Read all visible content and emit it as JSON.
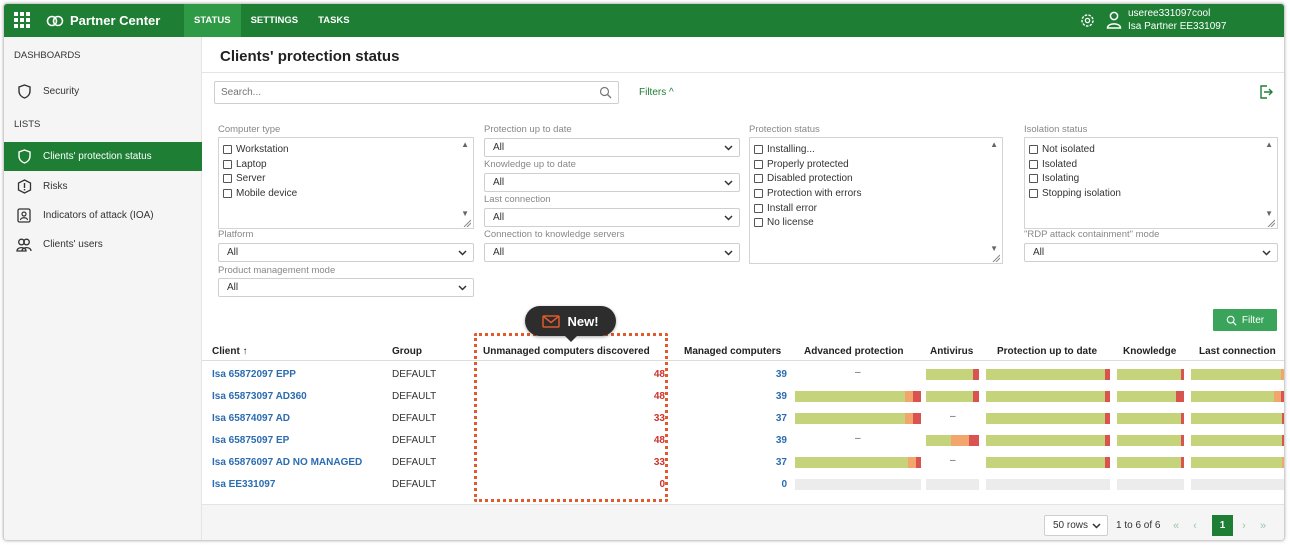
{
  "colors": {
    "brand": "#1e7e34",
    "bar_green": "#c5d47b",
    "bar_orange": "#f2a56c",
    "bar_red": "#d9534f",
    "bar_empty": "#ececec",
    "unmanaged_red": "#d0312d",
    "link_blue": "#2b6cb0",
    "highlight": "#e05a2b"
  },
  "topbar": {
    "apps_icon": "apps-grid-icon",
    "brand": "Partner Center",
    "nav": [
      "STATUS",
      "SETTINGS",
      "TASKS"
    ],
    "user_name": "useree331097cool",
    "user_org": "Isa Partner EE331097"
  },
  "sidebar": {
    "dashboards_label": "DASHBOARDS",
    "lists_label": "LISTS",
    "items": [
      {
        "label": "Security",
        "icon": "shield-icon"
      },
      {
        "label": "Clients' protection status",
        "icon": "shield-icon"
      },
      {
        "label": "Risks",
        "icon": "alert-icon"
      },
      {
        "label": "Indicators of attack (IOA)",
        "icon": "indicator-icon"
      },
      {
        "label": "Clients' users",
        "icon": "users-icon"
      }
    ]
  },
  "main": {
    "title": "Clients' protection status",
    "search_placeholder": "Search...",
    "filters_label": "Filters ^",
    "filter_button": "Filter",
    "filters": {
      "computer_type": {
        "label": "Computer type",
        "options": [
          "Workstation",
          "Laptop",
          "Server",
          "Mobile device"
        ]
      },
      "protection_up_to_date": {
        "label": "Protection up to date",
        "value": "All"
      },
      "knowledge_up_to_date": {
        "label": "Knowledge up to date",
        "value": "All"
      },
      "last_connection": {
        "label": "Last connection",
        "value": "All"
      },
      "connection_knowledge_servers": {
        "label": "Connection to knowledge servers",
        "value": "All"
      },
      "protection_status": {
        "label": "Protection status",
        "options": [
          "Installing...",
          "Properly protected",
          "Disabled protection",
          "Protection with errors",
          "Install error",
          "No license"
        ]
      },
      "isolation_status": {
        "label": "Isolation status",
        "options": [
          "Not isolated",
          "Isolated",
          "Isolating",
          "Stopping isolation"
        ]
      },
      "rdp_mode": {
        "label": "\"RDP attack containment\" mode",
        "value": "All"
      },
      "platform": {
        "label": "Platform",
        "value": "All"
      },
      "product_management_mode": {
        "label": "Product management mode",
        "value": "All"
      }
    },
    "new_badge": "New!",
    "table": {
      "columns": [
        "Client ↑",
        "Group",
        "Unmanaged computers discovered",
        "Managed computers",
        "Advanced protection",
        "Antivirus",
        "Protection up to date",
        "Knowledge",
        "Last connection"
      ],
      "dash": "–",
      "rows": [
        {
          "client": "Isa 65872097 EPP",
          "group": "DEFAULT",
          "unmanaged": "48",
          "managed": "39",
          "advanced": null,
          "antivirus": [
            0.88,
            0,
            0.12
          ],
          "protection": [
            0.96,
            0,
            0.04
          ],
          "knowledge": [
            0.96,
            0,
            0.04
          ],
          "last_connection": [
            0.95,
            0.05,
            0
          ]
        },
        {
          "client": "Isa 65873097 AD360",
          "group": "DEFAULT",
          "unmanaged": "48",
          "managed": "39",
          "advanced": [
            0.87,
            0.07,
            0.06
          ],
          "antivirus": [
            0.88,
            0,
            0.12
          ],
          "protection": [
            0.96,
            0,
            0.04
          ],
          "knowledge": [
            0.88,
            0,
            0.12
          ],
          "last_connection": [
            0.87,
            0.08,
            0.05
          ]
        },
        {
          "client": "Isa 65874097 AD",
          "group": "DEFAULT",
          "unmanaged": "33",
          "managed": "37",
          "advanced": [
            0.87,
            0.07,
            0.06
          ],
          "antivirus": null,
          "protection": [
            0.96,
            0,
            0.04
          ],
          "knowledge": [
            0.96,
            0,
            0.04
          ],
          "last_connection": [
            0.96,
            0,
            0.04
          ]
        },
        {
          "client": "Isa 65875097 EP",
          "group": "DEFAULT",
          "unmanaged": "48",
          "managed": "39",
          "advanced": null,
          "antivirus": [
            0.47,
            0.35,
            0.18
          ],
          "protection": [
            0.96,
            0,
            0.04
          ],
          "knowledge": [
            0.96,
            0,
            0.04
          ],
          "last_connection": [
            0.96,
            0,
            0.04
          ]
        },
        {
          "client": "Isa 65876097 AD NO MANAGED",
          "group": "DEFAULT",
          "unmanaged": "33",
          "managed": "37",
          "advanced": [
            0.9,
            0.06,
            0.04
          ],
          "antivirus": null,
          "protection": [
            0.96,
            0,
            0.04
          ],
          "knowledge": [
            0.96,
            0,
            0.04
          ],
          "last_connection": [
            0.96,
            0.04,
            0
          ]
        },
        {
          "client": "Isa EE331097",
          "group": "DEFAULT",
          "unmanaged": "0",
          "managed": "0",
          "advanced": [],
          "antivirus": [],
          "protection": [],
          "knowledge": [],
          "last_connection": []
        }
      ]
    },
    "pagination": {
      "rows_per_page": "50 rows",
      "range_text": "1 to 6 of 6",
      "first": "«",
      "prev": "‹",
      "current": "1",
      "next": "›",
      "last": "»"
    }
  }
}
